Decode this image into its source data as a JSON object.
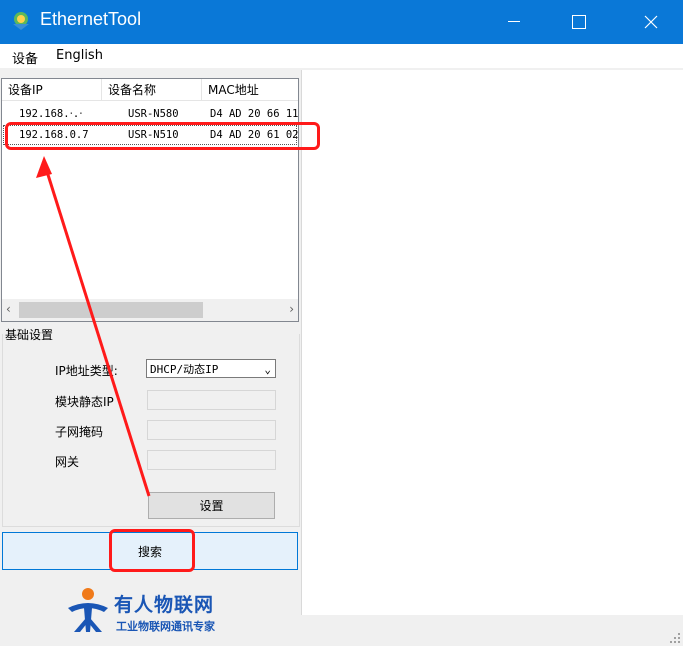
{
  "window": {
    "title": "EthernetTool"
  },
  "menu": {
    "items": [
      "设备",
      "English"
    ]
  },
  "device_list": {
    "columns": [
      "设备IP",
      "设备名称",
      "MAC地址"
    ],
    "rows": [
      {
        "ip": "192.168.‧.‧",
        "name": "USR-N580",
        "mac": "D4 AD 20 66 11"
      },
      {
        "ip": "192.168.0.7",
        "name": "USR-N510",
        "mac": "D4 AD 20 61 02"
      }
    ]
  },
  "basic_settings": {
    "title": "基础设置",
    "ip_type_label": "IP地址类型:",
    "ip_type_value": "DHCP/动态IP",
    "static_ip_label": "模块静态IP",
    "subnet_label": "子网掩码",
    "gateway_label": "网关",
    "setup_button": "设置"
  },
  "search_button": "搜索",
  "logo": {
    "brand": "有人物联网",
    "tagline": "工业物联网通讯专家"
  },
  "colors": {
    "titlebar": "#0a78d7",
    "highlight": "#ff1a1a",
    "brand": "#1a56b5"
  }
}
